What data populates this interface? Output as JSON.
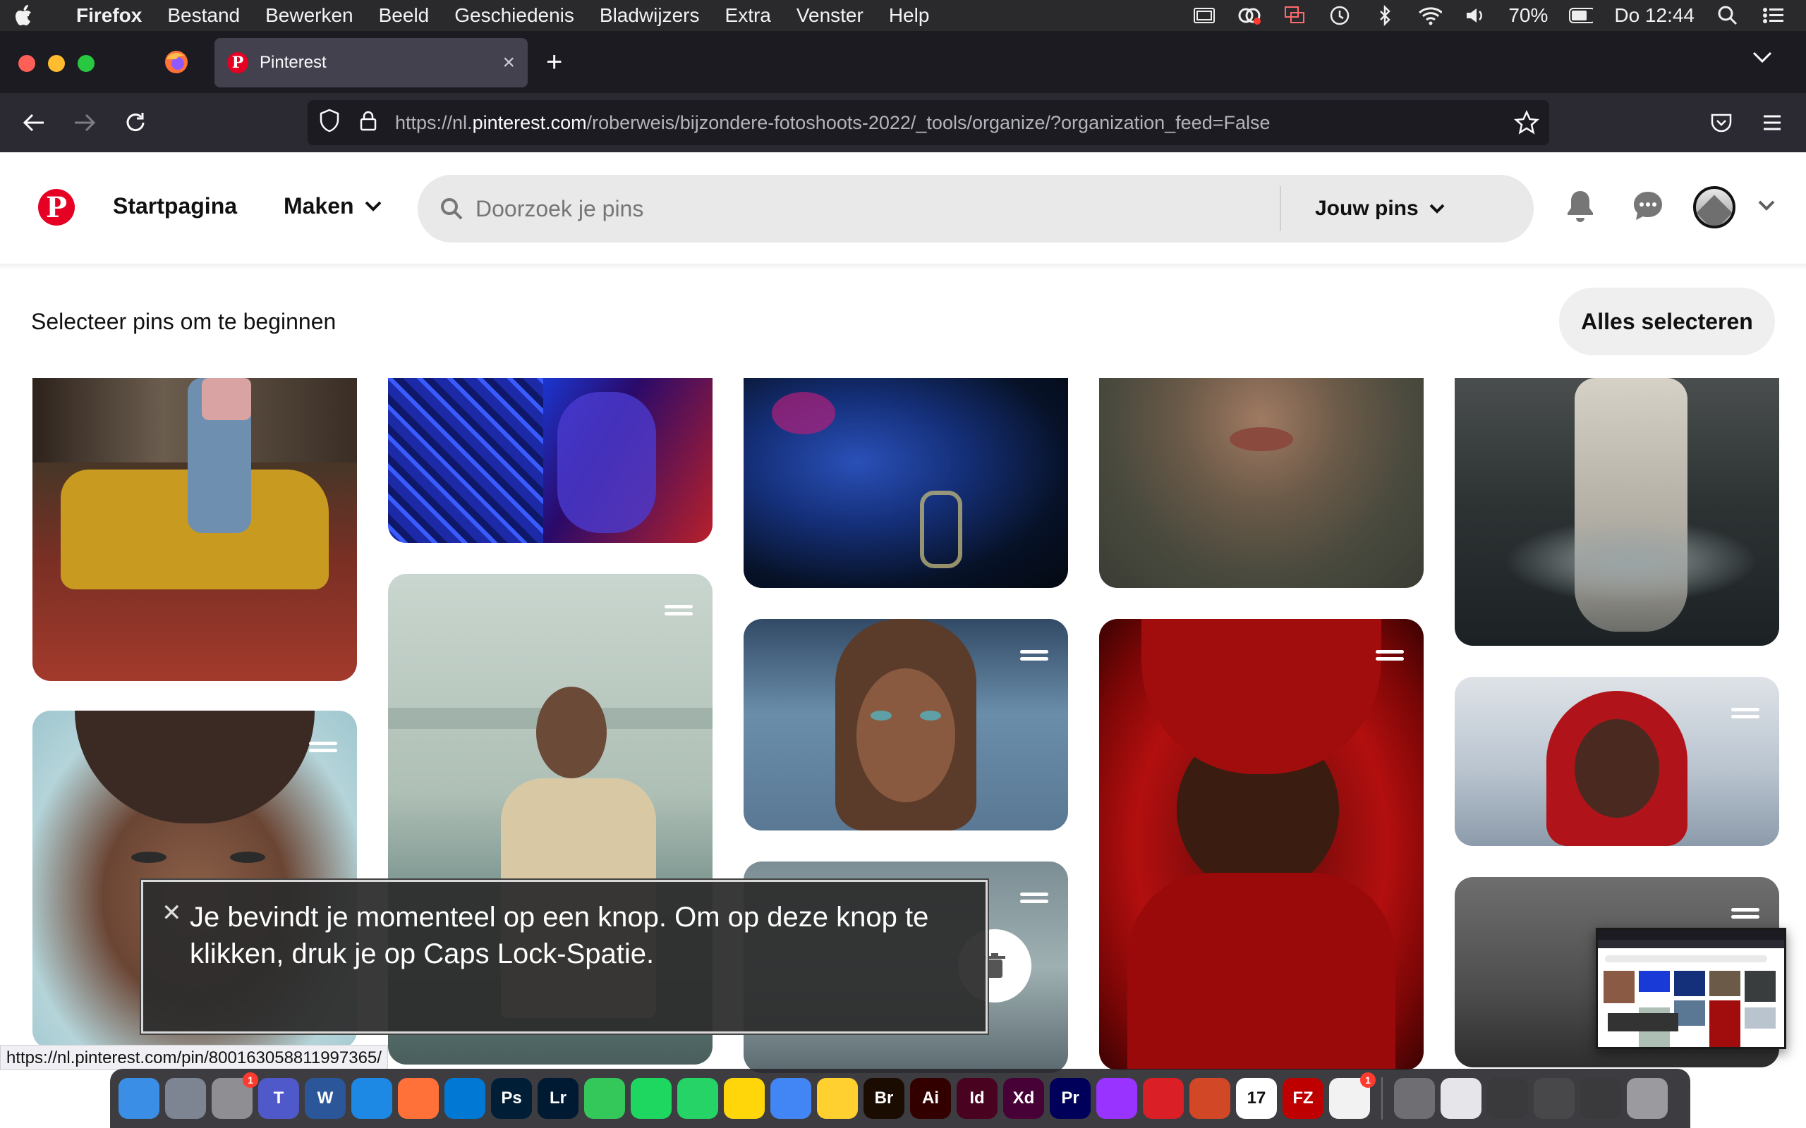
{
  "menubar": {
    "app_name": "Firefox",
    "items": [
      "Bestand",
      "Bewerken",
      "Beeld",
      "Geschiedenis",
      "Bladwijzers",
      "Extra",
      "Venster",
      "Help"
    ],
    "battery": "70%",
    "clock": "Do 12:44"
  },
  "browser": {
    "tab_title": "Pinterest",
    "url_prefix": "https://nl.",
    "url_host": "pinterest.com",
    "url_path": "/roberweis/bijzondere-fotoshoots-2022/_tools/organize/?organization_feed=False"
  },
  "pinterest": {
    "nav": {
      "home": "Startpagina",
      "create": "Maken"
    },
    "search": {
      "placeholder": "Doorzoek je pins",
      "scope": "Jouw pins"
    },
    "select_prompt": "Selecteer pins om te beginnen",
    "select_all": "Alles selecteren"
  },
  "voiceover": {
    "caption": "Je bevindt je momenteel op een knop. Om op deze knop te klikken, druk je op Caps Lock-Spatie."
  },
  "status_link": "https://nl.pinterest.com/pin/800163058811997365/",
  "dock": {
    "apps": [
      {
        "name": "Finder",
        "label": "",
        "color": "#3a8ee6"
      },
      {
        "name": "Launchpad",
        "label": "",
        "color": "#7c8591"
      },
      {
        "name": "System Preferences",
        "label": "",
        "color": "#8e8e93",
        "badge": "1"
      },
      {
        "name": "Teams",
        "label": "T",
        "color": "#5059c9"
      },
      {
        "name": "Word",
        "label": "W",
        "color": "#2b579a"
      },
      {
        "name": "Safari",
        "label": "",
        "color": "#1e88e5"
      },
      {
        "name": "Firefox",
        "label": "",
        "color": "#ff7139"
      },
      {
        "name": "VS Code",
        "label": "",
        "color": "#0078d4"
      },
      {
        "name": "Photoshop",
        "label": "Ps",
        "color": "#001e36"
      },
      {
        "name": "Lightroom",
        "label": "Lr",
        "color": "#001a33"
      },
      {
        "name": "FaceTime",
        "label": "",
        "color": "#34c759"
      },
      {
        "name": "Spotify",
        "label": "",
        "color": "#1ed760"
      },
      {
        "name": "WhatsApp",
        "label": "",
        "color": "#25d366"
      },
      {
        "name": "Notes",
        "label": "",
        "color": "#ffd60a"
      },
      {
        "name": "Chrome",
        "label": "",
        "color": "#4285f4"
      },
      {
        "name": "Miro",
        "label": "",
        "color": "#ffd02f"
      },
      {
        "name": "Bridge",
        "label": "Br",
        "color": "#1a0c00"
      },
      {
        "name": "Illustrator",
        "label": "Ai",
        "color": "#330000"
      },
      {
        "name": "InDesign",
        "label": "Id",
        "color": "#49021f"
      },
      {
        "name": "XD",
        "label": "Xd",
        "color": "#470137"
      },
      {
        "name": "Premiere",
        "label": "Pr",
        "color": "#00005b"
      },
      {
        "name": "Podcasts",
        "label": "",
        "color": "#9933ff"
      },
      {
        "name": "Creative Cloud",
        "label": "",
        "color": "#da1f26"
      },
      {
        "name": "PowerPoint",
        "label": "",
        "color": "#d24726"
      },
      {
        "name": "Calendar",
        "label": "17",
        "color": "#ffffff"
      },
      {
        "name": "FileZilla",
        "label": "FZ",
        "color": "#bf0000"
      },
      {
        "name": "Reminders",
        "label": "",
        "color": "#f2f2f2",
        "badge": "1"
      },
      {
        "name": "Accessibility",
        "label": "",
        "color": "#6e6e73"
      },
      {
        "name": "Document",
        "label": "",
        "color": "#e5e5ea"
      },
      {
        "name": "Window 1",
        "label": "",
        "color": "#3a3a3c"
      },
      {
        "name": "Window 2",
        "label": "",
        "color": "#48484a"
      },
      {
        "name": "Window 3",
        "label": "",
        "color": "#3a3a3c"
      },
      {
        "name": "Trash",
        "label": "",
        "color": "#9a9a9f"
      }
    ]
  },
  "icons": {
    "apple": "apple-icon",
    "search": "search-icon",
    "bell": "bell-icon",
    "messages": "messages-icon",
    "chevron": "chevron-down-icon",
    "handle": "drag-handle-icon"
  }
}
